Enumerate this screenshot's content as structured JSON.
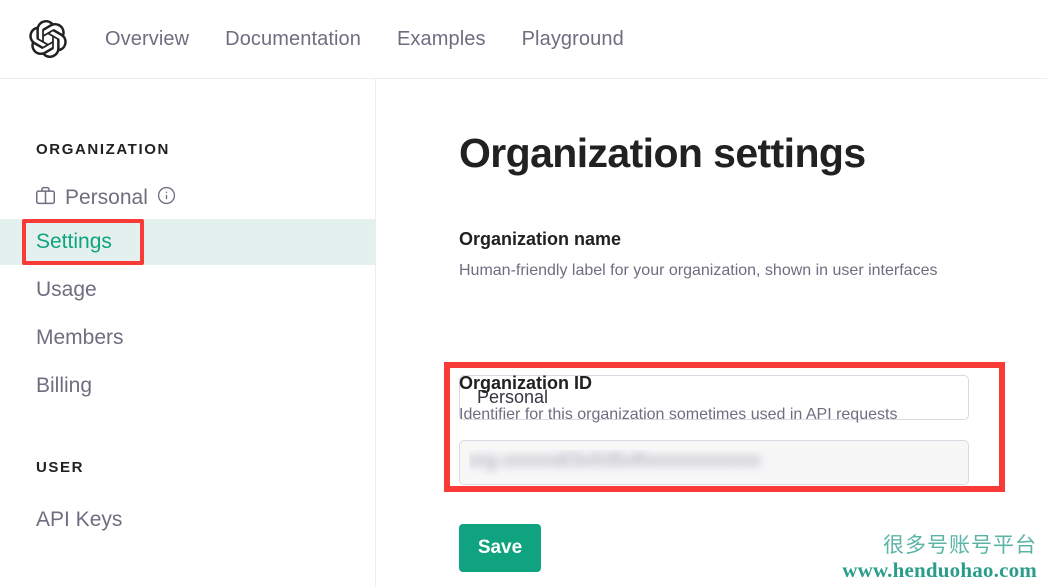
{
  "header": {
    "logo_icon": "openai-logo-icon",
    "nav": [
      {
        "label": "Overview"
      },
      {
        "label": "Documentation"
      },
      {
        "label": "Examples"
      },
      {
        "label": "Playground"
      }
    ]
  },
  "sidebar": {
    "organization_section_title": "ORGANIZATION",
    "organization": {
      "icon": "briefcase-icon",
      "name": "Personal",
      "info_icon": "info-circle-icon"
    },
    "items": [
      {
        "label": "Settings",
        "active": true
      },
      {
        "label": "Usage",
        "active": false
      },
      {
        "label": "Members",
        "active": false
      },
      {
        "label": "Billing",
        "active": false
      }
    ],
    "user_section_title": "USER",
    "user_items": [
      {
        "label": "API Keys",
        "active": false
      }
    ]
  },
  "main": {
    "page_title": "Organization settings",
    "org_name": {
      "label": "Organization name",
      "description": "Human-friendly label for your organization, shown in user interfaces",
      "value": "Personal"
    },
    "org_id": {
      "label": "Organization ID",
      "description": "Identifier for this organization sometimes used in API requests",
      "value": "org-xxxxxxE5v535vRxxxxxxxxxxxx",
      "redacted": true
    },
    "save_label": "Save"
  },
  "annotations": {
    "color": "#f83b36",
    "boxes": [
      {
        "target": "sidebar-item-settings"
      },
      {
        "target": "org-id-section"
      }
    ]
  },
  "watermark": {
    "line1": "很多号账号平台",
    "line2": "www.henduohao.com",
    "color": "#2a9d8a"
  },
  "colors": {
    "accent_green": "#10a37f",
    "active_bg": "#e3f0ed",
    "text_muted": "#6e6e80",
    "text_dark": "#202123",
    "border": "#d9d9e3"
  }
}
